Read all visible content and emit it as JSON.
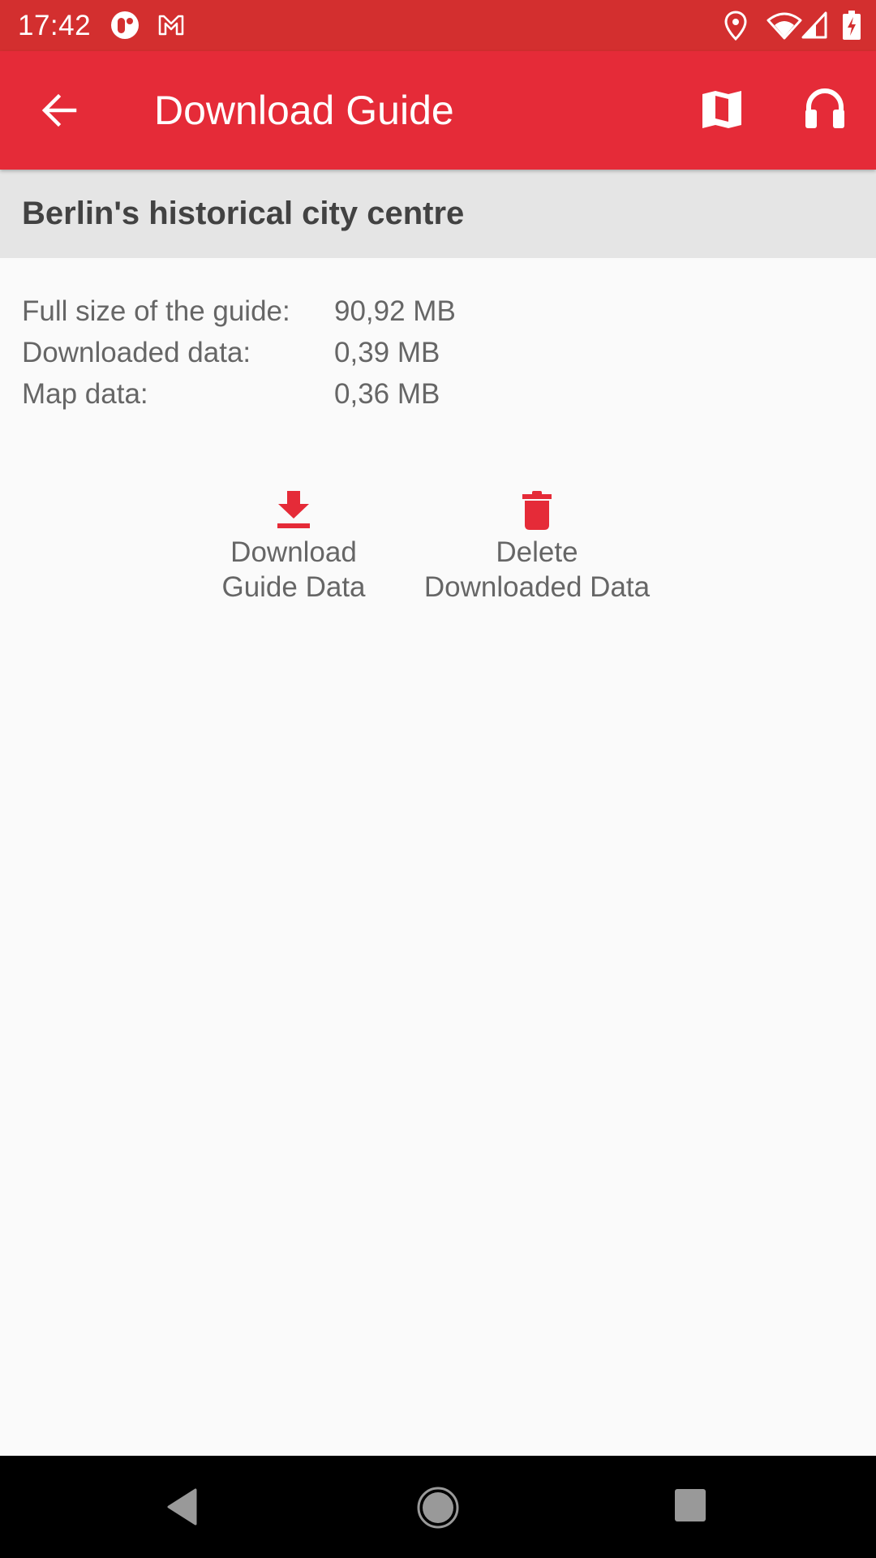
{
  "status_bar": {
    "time": "17:42",
    "left_icons": [
      "opera-icon",
      "gmail-icon"
    ],
    "right_icons": [
      "location-icon",
      "wifi-icon",
      "signal-icon",
      "battery-charging-icon"
    ]
  },
  "app_bar": {
    "title": "Download Guide",
    "back_icon": "arrow-left-icon",
    "actions": [
      {
        "name": "map-button",
        "icon": "map-icon"
      },
      {
        "name": "audio-button",
        "icon": "headphones-icon"
      }
    ],
    "color": "#e52b38"
  },
  "guide": {
    "title": "Berlin's historical city centre",
    "info": [
      {
        "label": "Full size of the guide:",
        "value": "90,92 MB"
      },
      {
        "label": "Downloaded data:",
        "value": "0,39 MB"
      },
      {
        "label": "Map data:",
        "value": "0,36 MB"
      }
    ]
  },
  "actions": {
    "download": {
      "line1": "Download",
      "line2": "Guide Data",
      "icon": "download-icon"
    },
    "delete": {
      "line1": "Delete",
      "line2": "Downloaded Data",
      "icon": "trash-icon"
    },
    "accent": "#e52b38"
  },
  "nav_bar": {
    "buttons": [
      "back",
      "home",
      "recents"
    ]
  }
}
